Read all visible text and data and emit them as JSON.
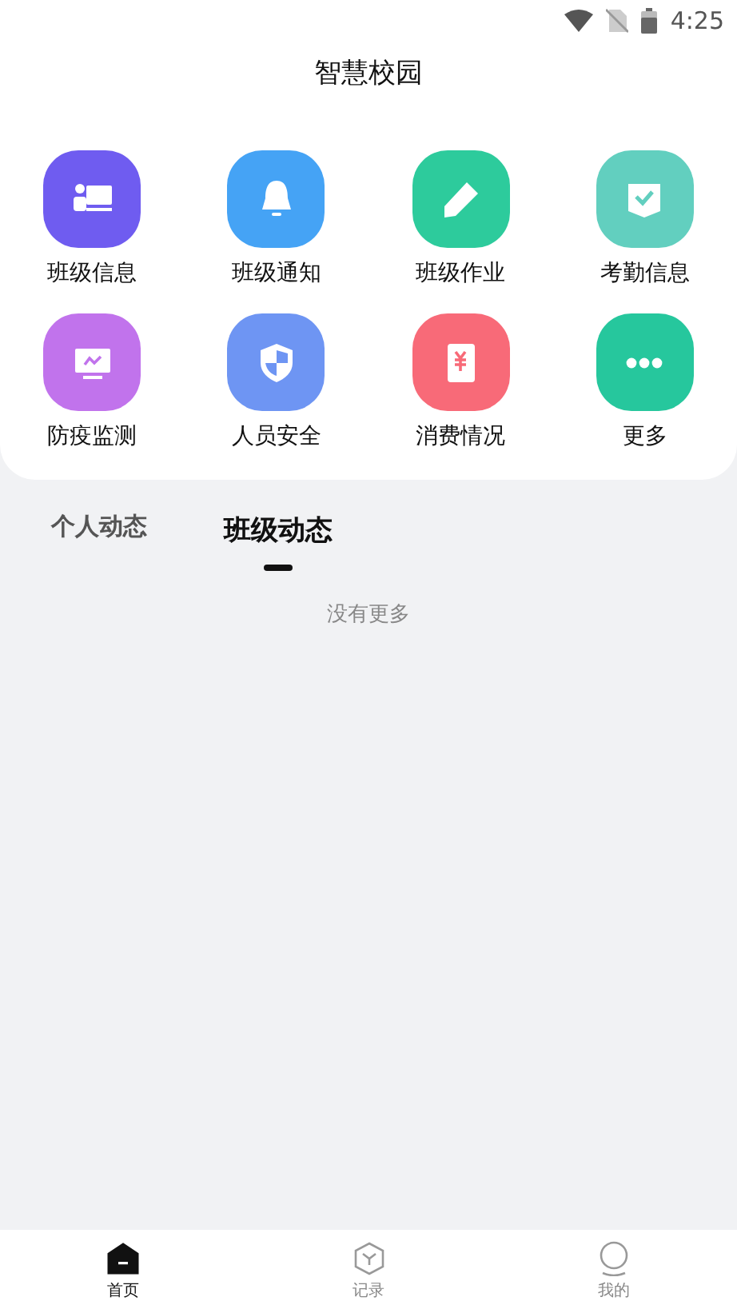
{
  "status_bar": {
    "time": "4:25"
  },
  "header": {
    "title": "智慧校园"
  },
  "apps": [
    {
      "label": "班级信息",
      "kind": "teacher",
      "color": "#6f5cf0"
    },
    {
      "label": "班级通知",
      "kind": "bell",
      "color": "#45a3f5"
    },
    {
      "label": "班级作业",
      "kind": "pencil",
      "color": "#2dcb9c"
    },
    {
      "label": "考勤信息",
      "kind": "check",
      "color": "#62cfbf"
    },
    {
      "label": "防疫监测",
      "kind": "monitor",
      "color": "#c173ec"
    },
    {
      "label": "人员安全",
      "kind": "shield",
      "color": "#6e95f3"
    },
    {
      "label": "消费情况",
      "kind": "yuan",
      "color": "#f86a78"
    },
    {
      "label": "更多",
      "kind": "more",
      "color": "#26c79d"
    }
  ],
  "tabs": [
    {
      "label": "个人动态",
      "selected": false
    },
    {
      "label": "班级动态",
      "selected": true
    }
  ],
  "feed": {
    "empty_text": "没有更多"
  },
  "bottom_nav": [
    {
      "label": "首页",
      "kind": "home",
      "selected": true
    },
    {
      "label": "记录",
      "kind": "cube",
      "selected": false
    },
    {
      "label": "我的",
      "kind": "person",
      "selected": false
    }
  ]
}
